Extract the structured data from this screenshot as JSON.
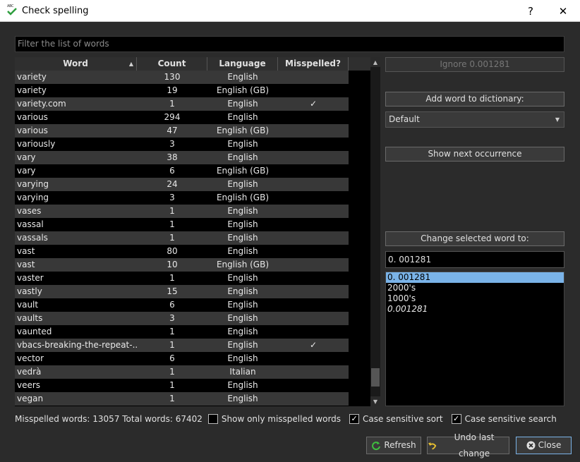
{
  "window": {
    "title": "Check spelling",
    "help_glyph": "?",
    "close_glyph": "✕"
  },
  "filter": {
    "placeholder": "Filter the list of words"
  },
  "table": {
    "headers": {
      "word": "Word",
      "count": "Count",
      "language": "Language",
      "misspelled": "Misspelled?"
    },
    "sort_indicator": "▲",
    "rows": [
      {
        "word": "variety",
        "count": "130",
        "language": "English",
        "misspelled": ""
      },
      {
        "word": "variety",
        "count": "19",
        "language": "English (GB)",
        "misspelled": ""
      },
      {
        "word": "variety.com",
        "count": "1",
        "language": "English",
        "misspelled": "✓"
      },
      {
        "word": "various",
        "count": "294",
        "language": "English",
        "misspelled": ""
      },
      {
        "word": "various",
        "count": "47",
        "language": "English (GB)",
        "misspelled": ""
      },
      {
        "word": "variously",
        "count": "3",
        "language": "English",
        "misspelled": ""
      },
      {
        "word": "vary",
        "count": "38",
        "language": "English",
        "misspelled": ""
      },
      {
        "word": "vary",
        "count": "6",
        "language": "English (GB)",
        "misspelled": ""
      },
      {
        "word": "varying",
        "count": "24",
        "language": "English",
        "misspelled": ""
      },
      {
        "word": "varying",
        "count": "3",
        "language": "English (GB)",
        "misspelled": ""
      },
      {
        "word": "vases",
        "count": "1",
        "language": "English",
        "misspelled": ""
      },
      {
        "word": "vassal",
        "count": "1",
        "language": "English",
        "misspelled": ""
      },
      {
        "word": "vassals",
        "count": "1",
        "language": "English",
        "misspelled": ""
      },
      {
        "word": "vast",
        "count": "80",
        "language": "English",
        "misspelled": ""
      },
      {
        "word": "vast",
        "count": "10",
        "language": "English (GB)",
        "misspelled": ""
      },
      {
        "word": "vaster",
        "count": "1",
        "language": "English",
        "misspelled": ""
      },
      {
        "word": "vastly",
        "count": "15",
        "language": "English",
        "misspelled": ""
      },
      {
        "word": "vault",
        "count": "6",
        "language": "English",
        "misspelled": ""
      },
      {
        "word": "vaults",
        "count": "3",
        "language": "English",
        "misspelled": ""
      },
      {
        "word": "vaunted",
        "count": "1",
        "language": "English",
        "misspelled": ""
      },
      {
        "word": "vbacs-breaking-the-repeat-...",
        "count": "1",
        "language": "English",
        "misspelled": "✓"
      },
      {
        "word": "vector",
        "count": "6",
        "language": "English",
        "misspelled": ""
      },
      {
        "word": "vedrà",
        "count": "1",
        "language": "Italian",
        "misspelled": ""
      },
      {
        "word": "veers",
        "count": "1",
        "language": "English",
        "misspelled": ""
      },
      {
        "word": "vegan",
        "count": "1",
        "language": "English",
        "misspelled": ""
      }
    ]
  },
  "scrollbar": {
    "up": "▲",
    "down": "▼"
  },
  "actions": {
    "ignore": "Ignore 0.001281",
    "add_to_dictionary": "Add word to dictionary:",
    "dictionary_selected": "Default",
    "dictionary_arrow": "▼",
    "show_next": "Show next occurrence",
    "change_to": "Change selected word to:",
    "change_value": "0. 001281",
    "suggestions": [
      "0. 001281",
      "2000's",
      "1000's",
      "0.001281"
    ]
  },
  "status": {
    "counts": "Misspelled words: 13057 Total words: 67402",
    "show_only_misspelled": {
      "label": "Show only misspelled words",
      "checked": false
    },
    "case_sensitive_sort": {
      "label": "Case sensitive sort",
      "checked": true
    },
    "case_sensitive_search": {
      "label": "Case sensitive search",
      "checked": true
    },
    "check_glyph": "✓"
  },
  "buttons": {
    "refresh": "Refresh",
    "undo": "Undo last change",
    "close": "Close"
  },
  "colors": {
    "background": "#2b2b2b",
    "row_alt": "#383838",
    "selection": "#7ab3e8"
  }
}
